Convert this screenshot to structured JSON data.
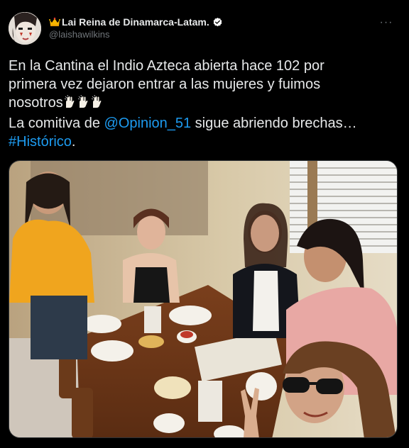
{
  "tweet": {
    "author": {
      "display_name": "Lai Reina de Dinamarca-Latam.",
      "handle": "@laishawilkins",
      "verified": true,
      "prefix_emoji": "crown"
    },
    "more_label": "···",
    "text": {
      "line1": "En la Cantina el Indio Azteca abierta hace 102 por",
      "line2": "primera vez dejaron entrar a las mujeres y fuimos",
      "line3": "nosotros",
      "line3_emoji": "raising-hands x3",
      "line4_before": "La comitiva de ",
      "mention": "@Opinion_51",
      "line4_after": " sigue abriendo brechas…",
      "hashtag": "#Histórico",
      "line5_after": "."
    },
    "media": {
      "type": "photo",
      "icon": "photo-icon"
    }
  },
  "colors": {
    "background": "#000000",
    "text": "#e7e9ea",
    "secondary": "#71767b",
    "link": "#1d9bf0",
    "verified": "#ffffff"
  }
}
